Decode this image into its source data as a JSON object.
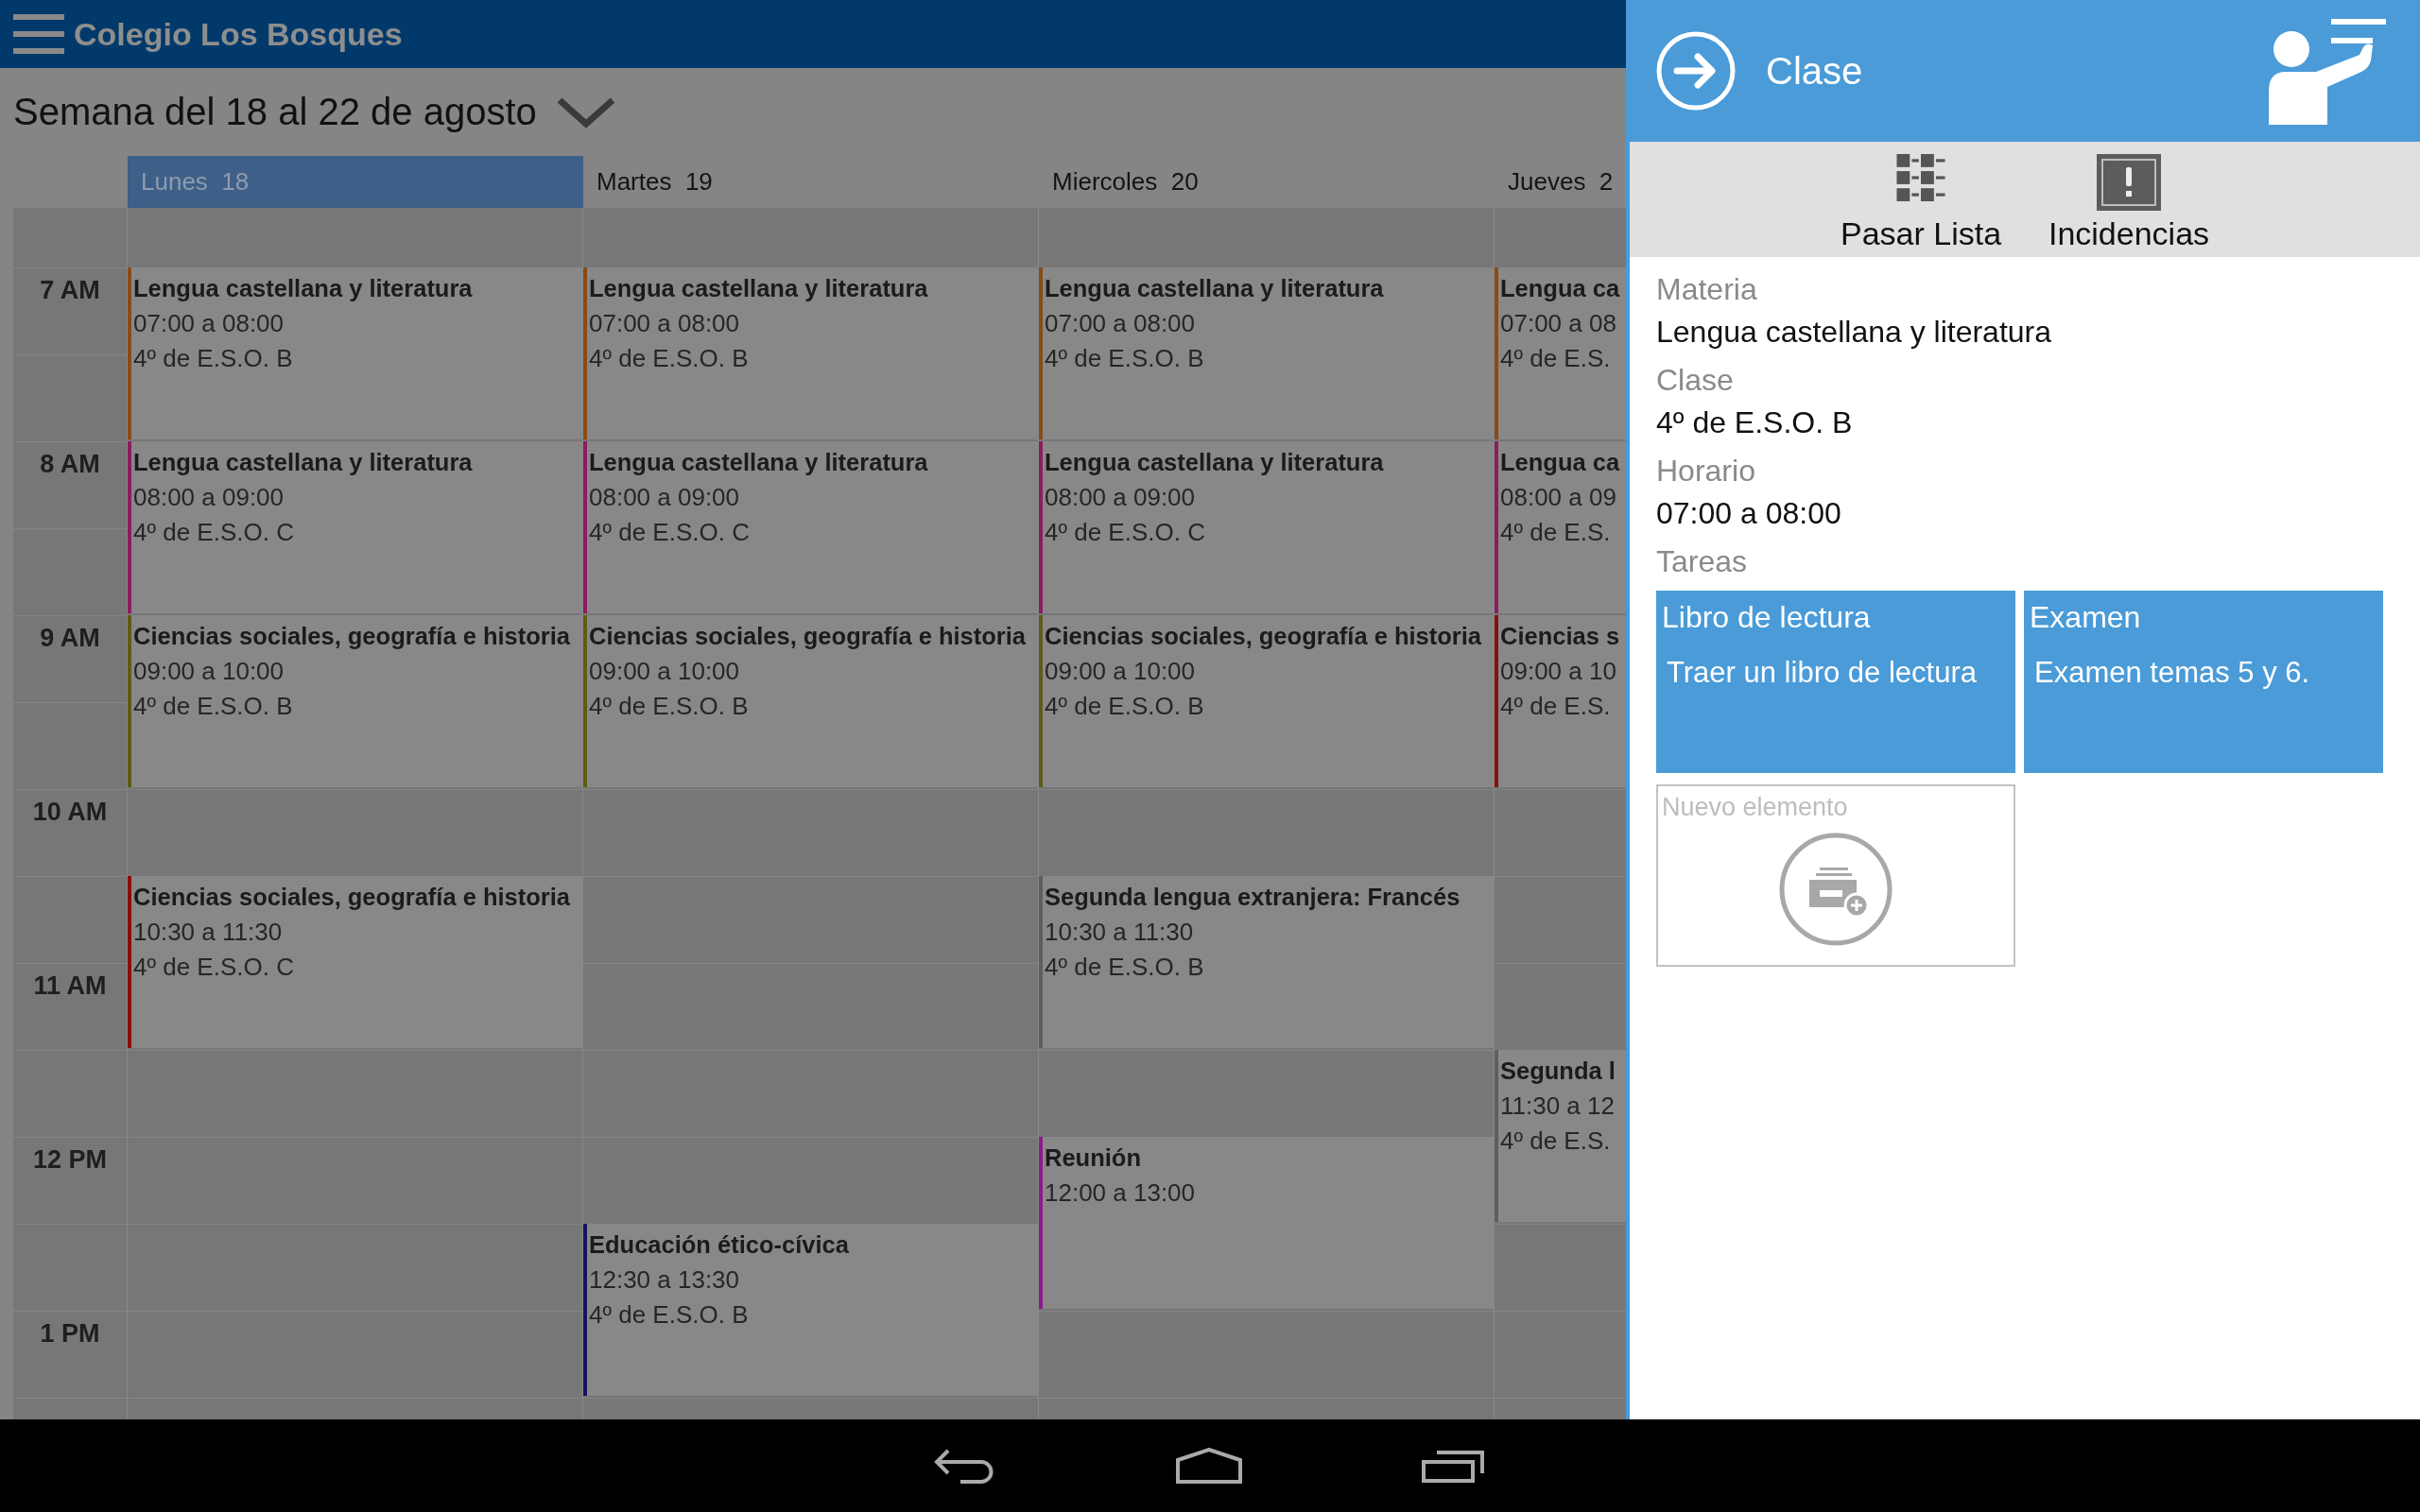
{
  "app_bar": {
    "title": "Colegio Los Bosques"
  },
  "week": {
    "label": "Semana del 18 al 22 de agosto"
  },
  "calendar": {
    "hours": [
      "7 AM",
      "8 AM",
      "9 AM",
      "10 AM",
      "11 AM",
      "12 PM",
      "1 PM"
    ],
    "days": [
      {
        "label": "Lunes  18",
        "selected": true,
        "events": [
          {
            "title": "Lengua castellana y literatura",
            "time": "07:00 a 08:00",
            "group": "4º de E.S.O. B",
            "color": "#8a4a16"
          },
          {
            "title": "Lengua castellana y literatura",
            "time": "08:00 a 09:00",
            "group": "4º de E.S.O. C",
            "color": "#8c1c5e"
          },
          {
            "title": "Ciencias sociales, geografía e historia",
            "time": "09:00 a 10:00",
            "group": "4º de E.S.O. B",
            "color": "#5e5c16"
          },
          {
            "title": "Ciencias sociales, geografía e historia",
            "time": "10:30 a 11:30",
            "group": "4º de E.S.O. C",
            "color": "#8c0c0c"
          }
        ]
      },
      {
        "label": "Martes  19",
        "selected": false,
        "events": [
          {
            "title": "Lengua castellana y literatura",
            "time": "07:00 a 08:00",
            "group": "4º de E.S.O. B",
            "color": "#8a4a16"
          },
          {
            "title": "Lengua castellana y literatura",
            "time": "08:00 a 09:00",
            "group": "4º de E.S.O. C",
            "color": "#8c1c5e"
          },
          {
            "title": "Ciencias sociales, geografía e historia",
            "time": "09:00 a 10:00",
            "group": "4º de E.S.O. B",
            "color": "#5e5c16"
          },
          {
            "title": "Educación ético-cívica",
            "time": "12:30 a 13:30",
            "group": "4º de E.S.O. B",
            "color": "#14145e"
          }
        ]
      },
      {
        "label": "Miercoles  20",
        "selected": false,
        "events": [
          {
            "title": "Lengua castellana y literatura",
            "time": "07:00 a 08:00",
            "group": "4º de E.S.O. B",
            "color": "#8a4a16"
          },
          {
            "title": "Lengua castellana y literatura",
            "time": "08:00 a 09:00",
            "group": "4º de E.S.O. C",
            "color": "#8c1c5e"
          },
          {
            "title": "Ciencias sociales, geografía e historia",
            "time": "09:00 a 10:00",
            "group": "4º de E.S.O. B",
            "color": "#5e5c16"
          },
          {
            "title": "Segunda lengua extranjera: Francés",
            "time": "10:30 a 11:30",
            "group": "4º de E.S.O. B",
            "color": "#5e5e5e"
          },
          {
            "title": "Reunión",
            "time": "12:00 a 13:00",
            "color": "#8c1a8c"
          }
        ]
      },
      {
        "label": "Jueves  2",
        "selected": false,
        "events": [
          {
            "title": "Lengua ca",
            "time": "07:00 a 08",
            "group": "4º de E.S.",
            "color": "#8a4a16"
          },
          {
            "title": "Lengua ca",
            "time": "08:00 a 09",
            "group": "4º de E.S.",
            "color": "#8c1c5e"
          },
          {
            "title": "Ciencias s",
            "time": "09:00 a 10",
            "group": "4º de E.S.",
            "color": "#8c0c0c"
          },
          {
            "title": "Segunda l",
            "time": "11:30 a 12",
            "group": "4º de E.S.",
            "color": "#5e5e5e"
          }
        ]
      }
    ]
  },
  "panel": {
    "title": "Clase",
    "actions": [
      {
        "label": "Pasar Lista",
        "kind": "list"
      },
      {
        "label": "Incidencias",
        "kind": "alert"
      }
    ],
    "fields": [
      {
        "label": "Materia",
        "value": "Lengua castellana y literatura"
      },
      {
        "label": "Clase",
        "value": "4º de E.S.O. B"
      },
      {
        "label": "Horario",
        "value": "07:00 a 08:00"
      }
    ],
    "tasks_label": "Tareas",
    "tasks": [
      {
        "title": "Libro de lectura",
        "description": "Traer un libro de lectura"
      },
      {
        "title": "Examen",
        "description": "Examen temas 5 y 6."
      }
    ],
    "new_item": {
      "label": "Nuevo elemento"
    }
  }
}
